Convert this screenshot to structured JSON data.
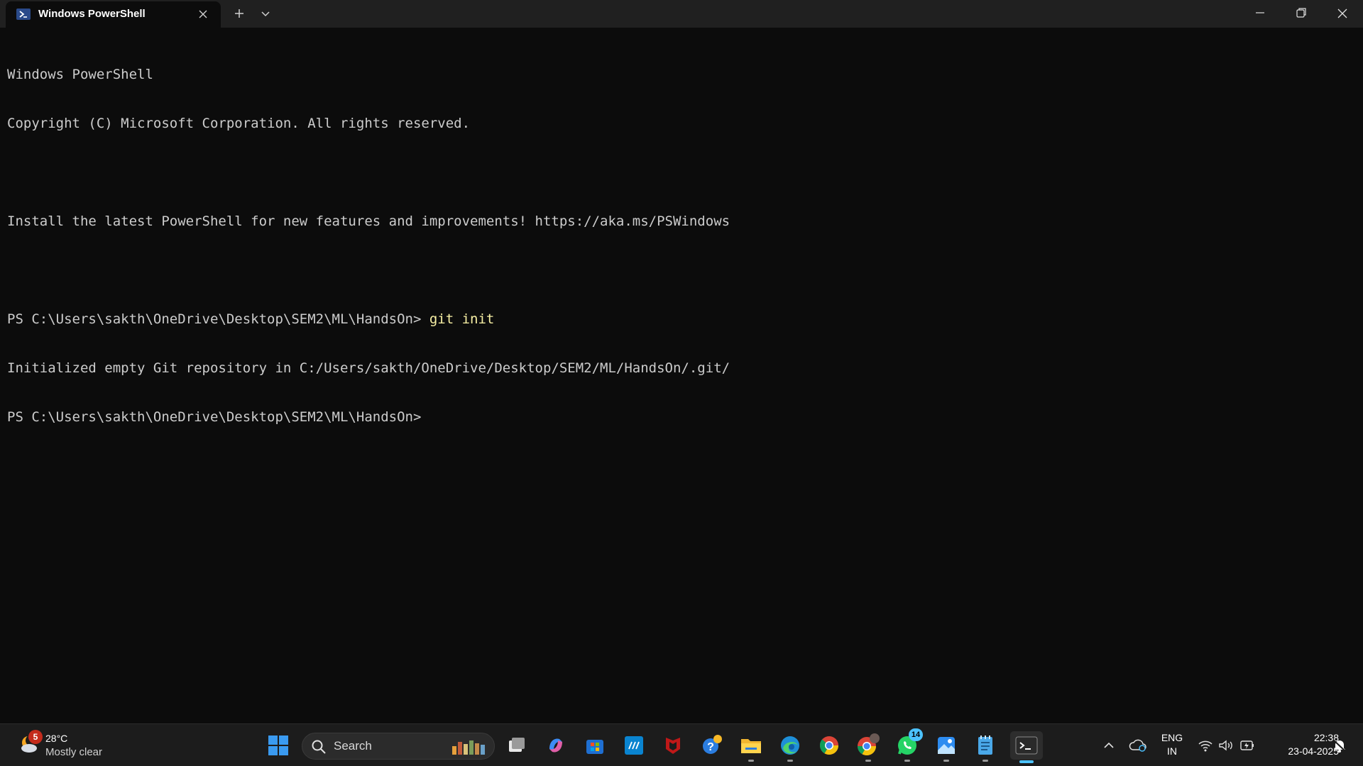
{
  "window": {
    "tab_title": "Windows PowerShell"
  },
  "console": {
    "lines": [
      "Windows PowerShell",
      "Copyright (C) Microsoft Corporation. All rights reserved.",
      "",
      "Install the latest PowerShell for new features and improvements! https://aka.ms/PSWindows",
      "",
      "PS C:\\Users\\sakth\\OneDrive\\Desktop\\SEM2\\ML\\HandsOn> ",
      "Initialized empty Git repository in C:/Users/sakth/OneDrive/Desktop/SEM2/ML/HandsOn/.git/",
      "PS C:\\Users\\sakth\\OneDrive\\Desktop\\SEM2\\ML\\HandsOn>"
    ],
    "command": "git init"
  },
  "taskbar": {
    "weather": {
      "badge": "5",
      "temperature": "28°C",
      "condition": "Mostly clear",
      "icon": "moon-cloud-icon"
    },
    "search": {
      "label": "Search"
    },
    "apps": [
      {
        "name": "start-button",
        "icon": "windows-logo-icon"
      },
      {
        "name": "task-view",
        "icon": "task-view-icon"
      },
      {
        "name": "copilot",
        "icon": "copilot-icon"
      },
      {
        "name": "microsoft-store",
        "icon": "store-icon"
      },
      {
        "name": "myhp",
        "icon": "myhp-icon"
      },
      {
        "name": "mcafee",
        "icon": "mcafee-icon"
      },
      {
        "name": "get-help",
        "icon": "help-icon"
      },
      {
        "name": "file-explorer",
        "icon": "folder-icon"
      },
      {
        "name": "edge",
        "icon": "edge-icon"
      },
      {
        "name": "chrome",
        "icon": "chrome-icon"
      },
      {
        "name": "chrome-profile",
        "icon": "chrome-profile-icon"
      },
      {
        "name": "whatsapp",
        "icon": "whatsapp-icon",
        "badge": "14"
      },
      {
        "name": "photos",
        "icon": "photos-icon"
      },
      {
        "name": "notepad",
        "icon": "notepad-icon"
      },
      {
        "name": "terminal",
        "icon": "terminal-icon"
      }
    ],
    "tray": {
      "lang_top": "ENG",
      "lang_bottom": "IN",
      "time": "22:38",
      "date": "23-04-2025"
    }
  },
  "colors": {
    "console_bg": "#0c0c0c",
    "console_text": "#cccccc",
    "command_text": "#f9f1a5",
    "accent": "#4cc2ff"
  }
}
